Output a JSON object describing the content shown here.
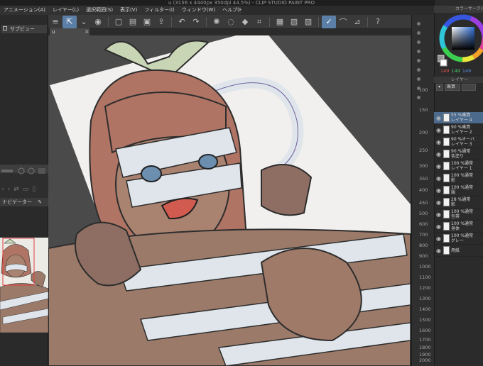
{
  "window": {
    "title": "u (3156 x 4440px 350dpi 44.5%) - CLIP STUDIO PAINT PRO"
  },
  "menu": [
    "アニメーション(A)",
    "レイヤー(L)",
    "選択範囲(S)",
    "表示(V)",
    "フィルター(I)",
    "ウィンドウ(W)",
    "ヘルプ(H)"
  ],
  "toolbar_icons": [
    "menu-icon",
    "move-icon",
    "dropdown-icon",
    "view-icon",
    "new-icon",
    "open-icon",
    "save-icon",
    "export-icon",
    "undo-icon",
    "redo-icon",
    "spinner-icon",
    "clear-icon",
    "fill-icon",
    "transform-icon",
    "grid-icon",
    "ruler-icon",
    "pen-icon",
    "brush-icon",
    "eraser-icon",
    "help-icon"
  ],
  "left_panel": {
    "subview_label": "サブビュー",
    "navigator_label": "ナビゲーター"
  },
  "document_tab": {
    "label": "u",
    "close": "×"
  },
  "ruler": {
    "labels": [
      "100",
      "150",
      "200",
      "250",
      "300",
      "350",
      "400",
      "450",
      "500",
      "600",
      "700",
      "800",
      "900",
      "1000",
      "1100",
      "1200",
      "1300",
      "1400",
      "1500",
      "1600",
      "1700",
      "1800",
      "1900",
      "2000"
    ]
  },
  "color_panel": {
    "header": "カラーサークル",
    "values": [
      "149",
      "149",
      "149"
    ]
  },
  "layer_panel": {
    "header": "レイヤー",
    "blend_mode": "乗算",
    "layers": [
      {
        "opacity": "55 %乗算",
        "name": "レイヤー 4",
        "selected": true
      },
      {
        "opacity": "90 %乗算",
        "name": "レイヤー 2",
        "selected": false
      },
      {
        "opacity": "90 %オーバ",
        "name": "レイヤー 3",
        "selected": false
      },
      {
        "opacity": "90 %通常",
        "name": "色塗り",
        "selected": false
      },
      {
        "opacity": "100 %通常",
        "name": "レイヤー 1",
        "selected": false
      },
      {
        "opacity": "100 %通常",
        "name": "影",
        "selected": false
      },
      {
        "opacity": "100 %通常",
        "name": "服",
        "selected": false
      },
      {
        "opacity": "28 %通常",
        "name": "影",
        "selected": false
      },
      {
        "opacity": "100 %通常",
        "name": "包帯",
        "selected": false
      },
      {
        "opacity": "100 %通常",
        "name": "身体",
        "selected": false
      },
      {
        "opacity": "100 %通常",
        "name": "グレー",
        "selected": false
      },
      {
        "opacity": "",
        "name": "用紙",
        "selected": false
      }
    ]
  },
  "colors": {
    "accent": "#5b7fa6",
    "hair": "#b07464",
    "skin": "#9c7a6a",
    "bandage": "#dfe5ea",
    "ribbon": "#c9d6b5"
  }
}
